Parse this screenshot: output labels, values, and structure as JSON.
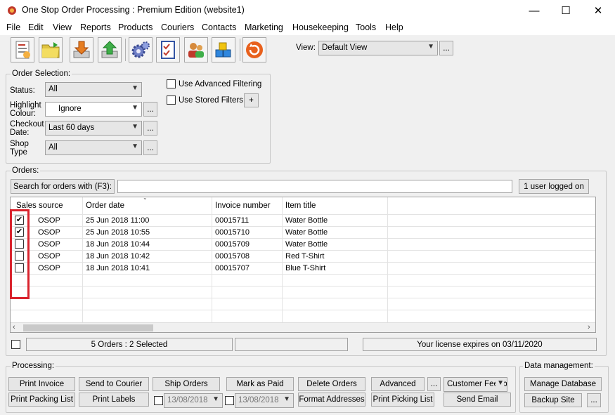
{
  "window": {
    "title": "One Stop Order Processing : Premium Edition (website1)",
    "minimize": "—",
    "maximize": "☐",
    "close": "✕"
  },
  "menu": [
    "File",
    "Edit",
    "View",
    "Reports",
    "Products",
    "Couriers",
    "Contacts",
    "Marketing",
    "Housekeeping",
    "Tools",
    "Help"
  ],
  "toolbar": {
    "icons": [
      "new-order-icon",
      "open-folder-icon",
      "download-icon",
      "upload-icon",
      "settings-gear-icon",
      "checklist-icon",
      "contacts-icon",
      "products-icon",
      "refresh-icon"
    ],
    "view_label": "View:",
    "view_value": "Default View",
    "view_more": "..."
  },
  "order_selection": {
    "title": "Order Selection:",
    "status_label": "Status:",
    "status_value": "All",
    "highlight_label": "Highlight Colour:",
    "highlight_value": "Ignore",
    "checkout_label": "Checkout Date:",
    "checkout_value": "Last 60 days",
    "shop_label": "Shop Type",
    "shop_value": "All",
    "more": "...",
    "adv_filter_label": "Use Advanced Filtering",
    "stored_filters_label": "Use Stored Filters",
    "add_filter": "+"
  },
  "orders": {
    "title": "Orders:",
    "search_button": "Search for orders with (F3):",
    "search_value": "",
    "users_button": "1 user logged on",
    "columns": [
      "Sales source",
      "Order date",
      "Invoice number",
      "Item title"
    ],
    "rows": [
      {
        "checked": true,
        "mark": "✔",
        "source": "OSOP",
        "date": "25 Jun 2018 11:00",
        "invoice": "00015711",
        "item": "Water Bottle"
      },
      {
        "checked": true,
        "mark": "✔",
        "source": "OSOP",
        "date": "25 Jun 2018 10:55",
        "invoice": "00015710",
        "item": "Water Bottle"
      },
      {
        "checked": false,
        "mark": "",
        "source": "OSOP",
        "date": "18 Jun 2018 10:44",
        "invoice": "00015709",
        "item": "Water Bottle"
      },
      {
        "checked": false,
        "mark": "",
        "source": "OSOP",
        "date": "18 Jun 2018 10:42",
        "invoice": "00015708",
        "item": "Red T-Shirt"
      },
      {
        "checked": false,
        "mark": "",
        "source": "OSOP",
        "date": "18 Jun 2018 10:41",
        "invoice": "00015707",
        "item": "Blue T-Shirt"
      }
    ],
    "highlight_color": "#d9232d",
    "summary": "5 Orders : 2 Selected",
    "license": "Your license expires on 03/11/2020"
  },
  "processing": {
    "title": "Processing:",
    "print_invoice": "Print Invoice",
    "print_packing_list": "Print Packing List",
    "send_to_courier": "Send to Courier",
    "print_labels": "Print Labels",
    "ship_orders": "Ship Orders",
    "ship_date": "13/08/2018",
    "mark_as_paid": "Mark as Paid",
    "paid_date": "13/08/2018",
    "delete_orders": "Delete Orders",
    "format_addresses": "Format Addresses",
    "advanced": "Advanced",
    "advanced_more": "...",
    "print_picking_list": "Print Picking List",
    "customer_feedback": "Customer Feedback",
    "send_email": "Send Email"
  },
  "data_management": {
    "title": "Data management:",
    "manage_database": "Manage Database",
    "backup_site": "Backup Site",
    "more": "..."
  }
}
